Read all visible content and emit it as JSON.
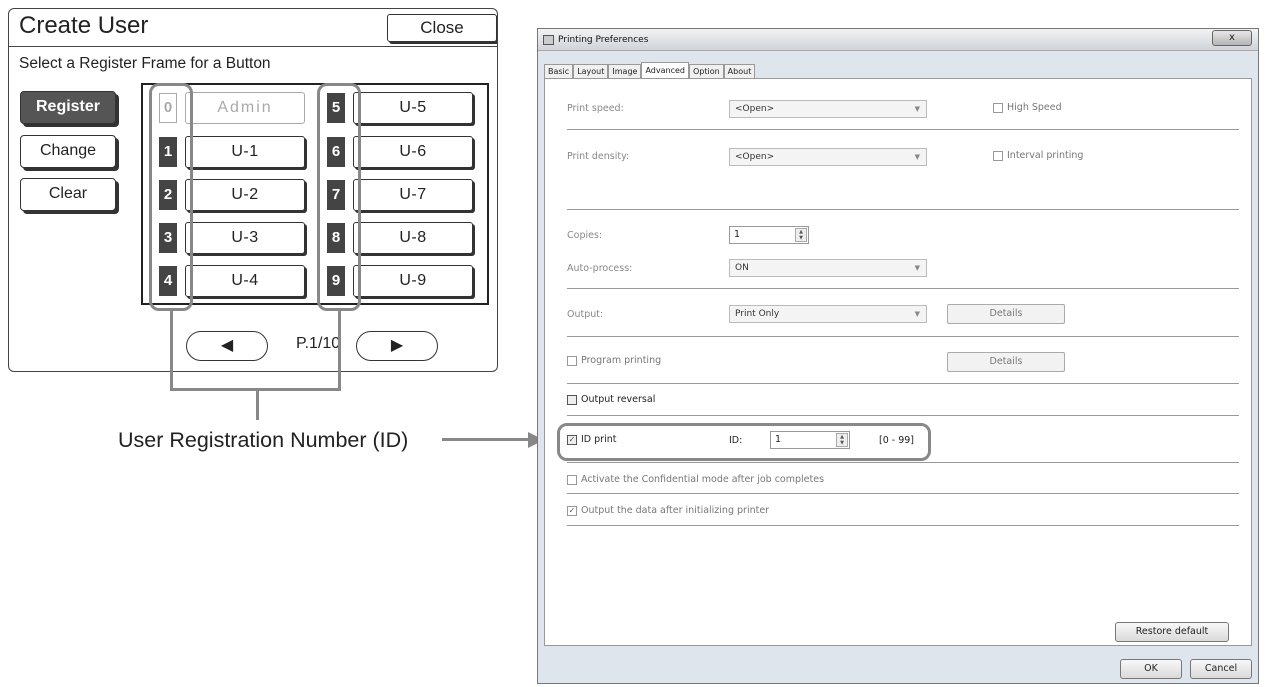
{
  "create_user": {
    "title": "Create User",
    "close_label": "Close",
    "subtitle": "Select a Register Frame for a Button",
    "side_buttons": [
      {
        "label": "Register",
        "active": true
      },
      {
        "label": "Change",
        "active": false
      },
      {
        "label": "Clear",
        "active": false
      }
    ],
    "left_column": [
      {
        "num": "0",
        "label": "Admin",
        "dim": true
      },
      {
        "num": "1",
        "label": "U-1"
      },
      {
        "num": "2",
        "label": "U-2"
      },
      {
        "num": "3",
        "label": "U-3"
      },
      {
        "num": "4",
        "label": "U-4"
      }
    ],
    "right_column": [
      {
        "num": "5",
        "label": "U-5"
      },
      {
        "num": "6",
        "label": "U-6"
      },
      {
        "num": "7",
        "label": "U-7"
      },
      {
        "num": "8",
        "label": "U-8"
      },
      {
        "num": "9",
        "label": "U-9"
      }
    ],
    "prev_icon": "◀",
    "next_icon": "▶",
    "page_label": "P.1/10"
  },
  "callout": {
    "caption": "User Registration Number (ID)"
  },
  "dialog": {
    "title": "Printing Preferences",
    "close_glyph": "x",
    "tabs": [
      {
        "label": "Basic"
      },
      {
        "label": "Layout"
      },
      {
        "label": "Image"
      },
      {
        "label": "Advanced",
        "active": true
      },
      {
        "label": "Option"
      },
      {
        "label": "About"
      }
    ],
    "print_speed": {
      "label": "Print speed:",
      "value": "<Open>",
      "check_label": "High Speed"
    },
    "print_density": {
      "label": "Print density:",
      "value": "<Open>",
      "check_label": "Interval printing"
    },
    "copies": {
      "label": "Copies:",
      "value": "1"
    },
    "auto_process": {
      "label": "Auto-process:",
      "value": "ON"
    },
    "output": {
      "label": "Output:",
      "value": "Print Only",
      "details_label": "Details"
    },
    "program_printing": {
      "label": "Program printing",
      "details_label": "Details"
    },
    "output_reversal": {
      "label": "Output reversal"
    },
    "id_print": {
      "label": "ID print",
      "id_label": "ID:",
      "id_value": "1",
      "range": "[0 - 99]",
      "checked": "✓"
    },
    "confidential": {
      "label": "Activate the Confidential mode after job completes"
    },
    "output_after_init": {
      "label": "Output the data after initializing printer",
      "checked": "✓"
    },
    "restore_label": "Restore default",
    "ok_label": "OK",
    "cancel_label": "Cancel"
  }
}
